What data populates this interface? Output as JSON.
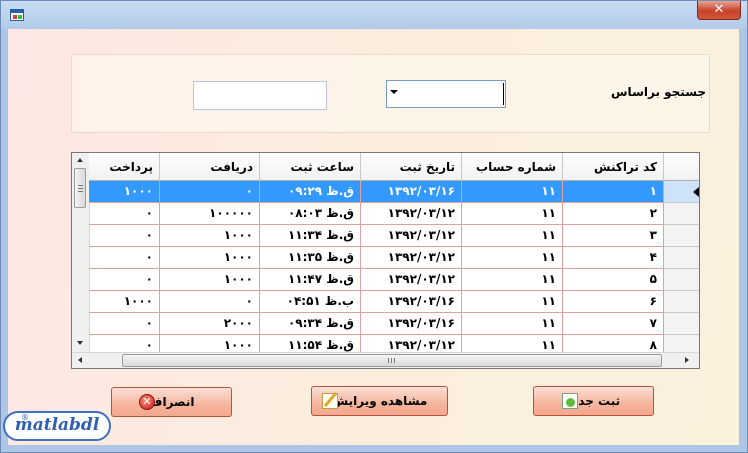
{
  "window": {
    "title": ""
  },
  "search": {
    "label": "جستجو براساس",
    "combo_value": "",
    "text_value": ""
  },
  "grid": {
    "columns": [
      "کد تراکنش",
      "شماره حساب",
      "تاریخ ثبت",
      "ساعت ثبت",
      "دریافت",
      "پرداخت"
    ],
    "rows": [
      {
        "code": "۱",
        "account": "۱۱",
        "date": "۱۳۹۲/۰۳/۱۶",
        "time": "۰۹:۲۹ ق.ظ",
        "received": "۰",
        "paid": "۱۰۰۰"
      },
      {
        "code": "۲",
        "account": "۱۱",
        "date": "۱۳۹۲/۰۳/۱۲",
        "time": "۰۸:۰۳ ق.ظ",
        "received": "۱۰۰۰۰۰",
        "paid": "۰"
      },
      {
        "code": "۳",
        "account": "۱۱",
        "date": "۱۳۹۲/۰۳/۱۲",
        "time": "۱۱:۳۴ ق.ظ",
        "received": "۱۰۰۰",
        "paid": "۰"
      },
      {
        "code": "۴",
        "account": "۱۱",
        "date": "۱۳۹۲/۰۳/۱۲",
        "time": "۱۱:۳۵ ق.ظ",
        "received": "۱۰۰۰",
        "paid": "۰"
      },
      {
        "code": "۵",
        "account": "۱۱",
        "date": "۱۳۹۲/۰۳/۱۲",
        "time": "۱۱:۴۷ ق.ظ",
        "received": "۱۰۰۰",
        "paid": "۰"
      },
      {
        "code": "۶",
        "account": "۱۱",
        "date": "۱۳۹۲/۰۳/۱۶",
        "time": "۰۴:۵۱ ب.ظ",
        "received": "۰",
        "paid": "۱۰۰۰"
      },
      {
        "code": "۷",
        "account": "۱۱",
        "date": "۱۳۹۲/۰۳/۱۶",
        "time": "۰۹:۳۴ ق.ظ",
        "received": "۲۰۰۰",
        "paid": "۰"
      },
      {
        "code": "۸",
        "account": "۱۱",
        "date": "۱۳۹۲/۰۳/۱۲",
        "time": "۱۱:۵۴ ق.ظ",
        "received": "۱۰۰۰",
        "paid": "۰"
      }
    ],
    "selected_row": 0
  },
  "buttons": {
    "cancel": "انصراف",
    "view_edit": "مشاهده ویرایش",
    "new": "ثبت جدید"
  },
  "logo": {
    "text": "matlabdl",
    "mark": "®"
  },
  "icons": {
    "close": "close-icon",
    "app": "app-icon",
    "cancel": "cancel-icon",
    "edit": "edit-icon",
    "new": "add-document-icon",
    "row_pointer": "row-pointer-icon"
  },
  "colors": {
    "selection": "#3399ff",
    "grid_line": "#e0a0a0",
    "button": "#f5b49c",
    "background": "#fbeedd"
  }
}
